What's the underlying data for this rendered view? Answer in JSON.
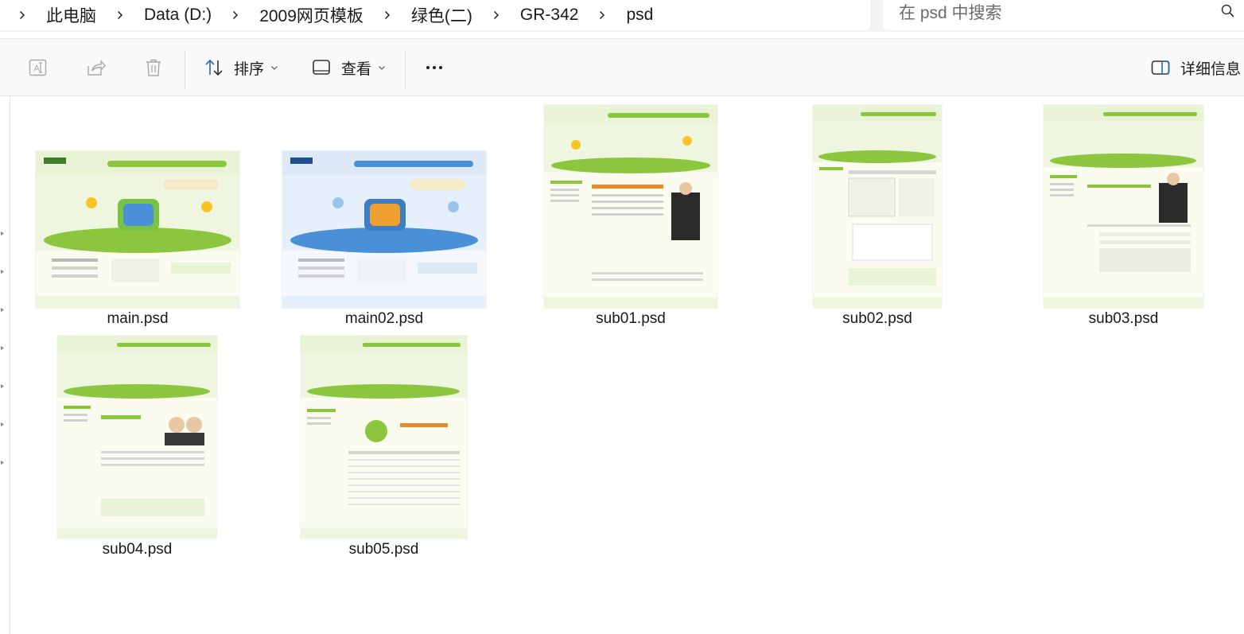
{
  "address_bar": {
    "breadcrumbs": [
      "此电脑",
      "Data (D:)",
      "2009网页模板",
      "绿色(二)",
      "GR-342",
      "psd"
    ]
  },
  "search": {
    "placeholder": "在 psd 中搜索"
  },
  "toolbar": {
    "sort_label": "排序",
    "view_label": "查看",
    "details_label": "详细信息"
  },
  "files": [
    {
      "name": "main.psd",
      "theme": "#7cc242"
    },
    {
      "name": "main02.psd",
      "theme": "#4a90d6"
    },
    {
      "name": "sub01.psd",
      "theme": "#7cc242"
    },
    {
      "name": "sub02.psd",
      "theme": "#7cc242"
    },
    {
      "name": "sub03.psd",
      "theme": "#7cc242"
    },
    {
      "name": "sub04.psd",
      "theme": "#7cc242"
    },
    {
      "name": "sub05.psd",
      "theme": "#7cc242"
    }
  ]
}
